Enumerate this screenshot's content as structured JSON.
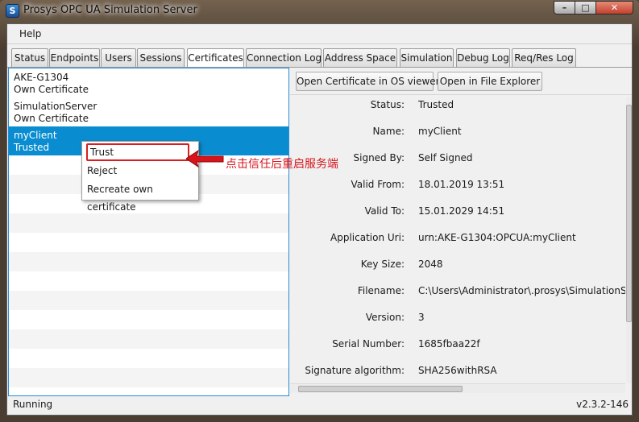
{
  "window": {
    "title": "Prosys OPC UA Simulation Server",
    "icon_letter": "S",
    "minimize_glyph": "–",
    "maximize_glyph": "□",
    "close_glyph": "✕"
  },
  "menu": {
    "help": "Help"
  },
  "tabs": [
    {
      "label": "Status"
    },
    {
      "label": "Endpoints"
    },
    {
      "label": "Users"
    },
    {
      "label": "Sessions"
    },
    {
      "label": "Certificates",
      "active": true
    },
    {
      "label": "Connection Log"
    },
    {
      "label": "Address Space"
    },
    {
      "label": "Simulation"
    },
    {
      "label": "Debug Log"
    },
    {
      "label": "Req/Res Log"
    }
  ],
  "certificates": [
    {
      "name": "AKE-G1304",
      "status": "Own Certificate"
    },
    {
      "name": "SimulationServer",
      "status": "Own Certificate"
    },
    {
      "name": "myClient",
      "status": "Trusted",
      "selected": true
    }
  ],
  "toolbar": {
    "open_os_viewer": "Open Certificate in OS viewer",
    "open_explorer": "Open in File Explorer"
  },
  "details": [
    {
      "label": "Status:",
      "value": "Trusted"
    },
    {
      "label": "Name:",
      "value": "myClient"
    },
    {
      "label": "Signed By:",
      "value": "Self Signed"
    },
    {
      "label": "Valid From:",
      "value": "18.01.2019 13:51"
    },
    {
      "label": "Valid To:",
      "value": "15.01.2029 14:51"
    },
    {
      "label": "Application Uri:",
      "value": "urn:AKE-G1304:OPCUA:myClient"
    },
    {
      "label": "Key Size:",
      "value": "2048"
    },
    {
      "label": "Filename:",
      "value": "C:\\Users\\Administrator\\.prosys\\SimulationServer"
    },
    {
      "label": "Version:",
      "value": "3"
    },
    {
      "label": "Serial Number:",
      "value": "1685fbaa22f"
    },
    {
      "label": "Signature algorithm:",
      "value": "SHA256withRSA"
    }
  ],
  "context_menu": {
    "trust": "Trust",
    "reject": "Reject",
    "recreate": "Recreate own certificate"
  },
  "annotation": {
    "text": "点击信任后重启服务端",
    "color": "#d8131a"
  },
  "statusbar": {
    "status": "Running",
    "version": "v2.3.2-146"
  },
  "colors": {
    "selection": "#0a8dd0",
    "list_border": "#2a8bd8",
    "highlight_box": "#d81e1e"
  }
}
